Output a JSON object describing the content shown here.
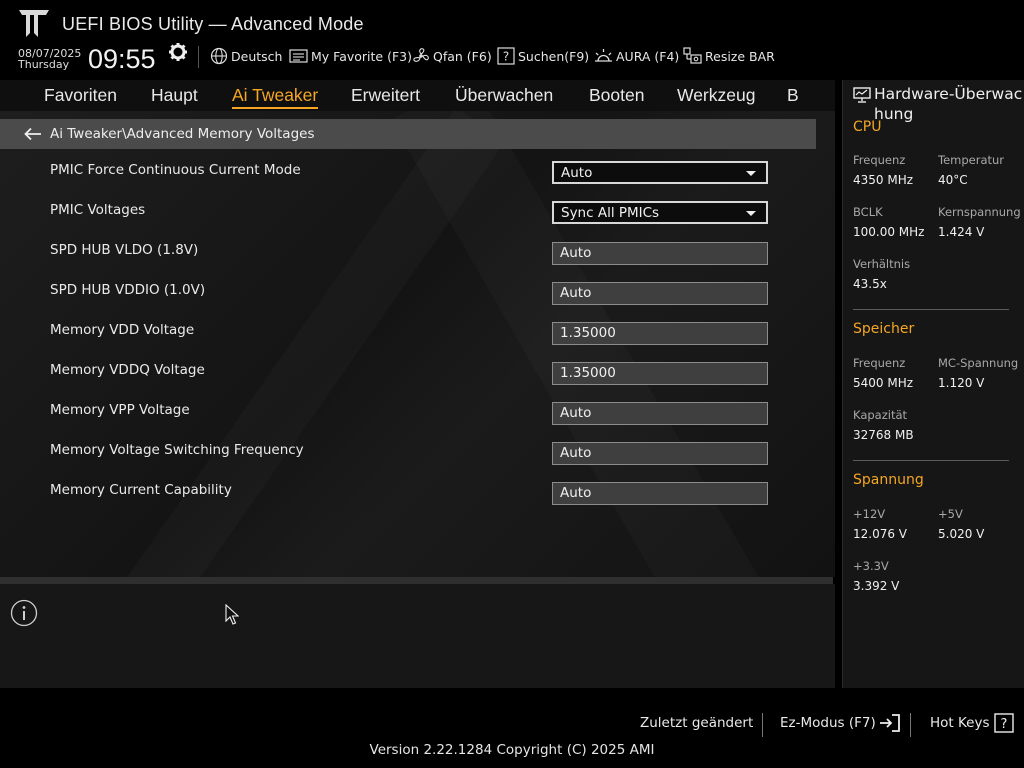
{
  "header": {
    "title": "UEFI BIOS Utility — Advanced Mode",
    "date": "08/07/2025",
    "weekday": "Thursday",
    "time": "09:55",
    "toolbar": [
      {
        "label": "Deutsch",
        "icon": "globe-icon"
      },
      {
        "label": "My Favorite (F3)",
        "icon": "favorite-icon"
      },
      {
        "label": "Qfan (F6)",
        "icon": "fan-icon"
      },
      {
        "label": "Suchen(F9)",
        "icon": "search-help-icon"
      },
      {
        "label": "AURA (F4)",
        "icon": "aura-icon"
      },
      {
        "label": "Resize BAR",
        "icon": "resize-bar-icon"
      }
    ]
  },
  "nav": {
    "tabs": [
      {
        "label": "Favoriten"
      },
      {
        "label": "Haupt"
      },
      {
        "label": "Ai Tweaker",
        "active": true
      },
      {
        "label": "Erweitert"
      },
      {
        "label": "Überwachen"
      },
      {
        "label": "Booten"
      },
      {
        "label": "Werkzeug"
      },
      {
        "label": "B"
      }
    ]
  },
  "main": {
    "breadcrumb": "Ai Tweaker\\Advanced Memory Voltages",
    "settings": [
      {
        "label": "PMIC Force Continuous Current Mode",
        "value": "Auto",
        "type": "dropdown"
      },
      {
        "label": "PMIC Voltages",
        "value": "Sync All PMICs",
        "type": "dropdown"
      },
      {
        "label": "SPD HUB VLDO (1.8V)",
        "value": "Auto",
        "type": "field"
      },
      {
        "label": "SPD HUB VDDIO (1.0V)",
        "value": "Auto",
        "type": "field"
      },
      {
        "label": "Memory VDD Voltage",
        "value": "1.35000",
        "type": "field"
      },
      {
        "label": "Memory VDDQ Voltage",
        "value": "1.35000",
        "type": "field"
      },
      {
        "label": "Memory VPP Voltage",
        "value": "Auto",
        "type": "field"
      },
      {
        "label": "Memory Voltage Switching Frequency",
        "value": "Auto",
        "type": "field"
      },
      {
        "label": "Memory Current Capability",
        "value": "Auto",
        "type": "field"
      }
    ]
  },
  "monitor": {
    "title": "Hardware-Überwachung",
    "cpu": {
      "heading": "CPU",
      "freq_label": "Frequenz",
      "freq": "4350 MHz",
      "temp_label": "Temperatur",
      "temp": "40°C",
      "bclk_label": "BCLK",
      "bclk": "100.00 MHz",
      "core_v_label": "Kernspannung",
      "core_v": "1.424 V",
      "ratio_label": "Verhältnis",
      "ratio": "43.5x"
    },
    "memory": {
      "heading": "Speicher",
      "freq_label": "Frequenz",
      "freq": "5400 MHz",
      "mc_v_label": "MC-Spannung",
      "mc_v": "1.120 V",
      "cap_label": "Kapazität",
      "cap": "32768 MB"
    },
    "voltage": {
      "heading": "Spannung",
      "v12_label": "+12V",
      "v12": "12.076 V",
      "v5_label": "+5V",
      "v5": "5.020 V",
      "v33_label": "+3.3V",
      "v33": "3.392 V"
    }
  },
  "footer": {
    "last_modified": "Zuletzt geändert",
    "ez_mode": "Ez-Modus (F7)",
    "hot_keys": "Hot Keys",
    "version": "Version 2.22.1284 Copyright (C) 2025 AMI"
  },
  "colors": {
    "accent": "#f5a623",
    "breadcrumb_bg": "#4b4b4b"
  }
}
